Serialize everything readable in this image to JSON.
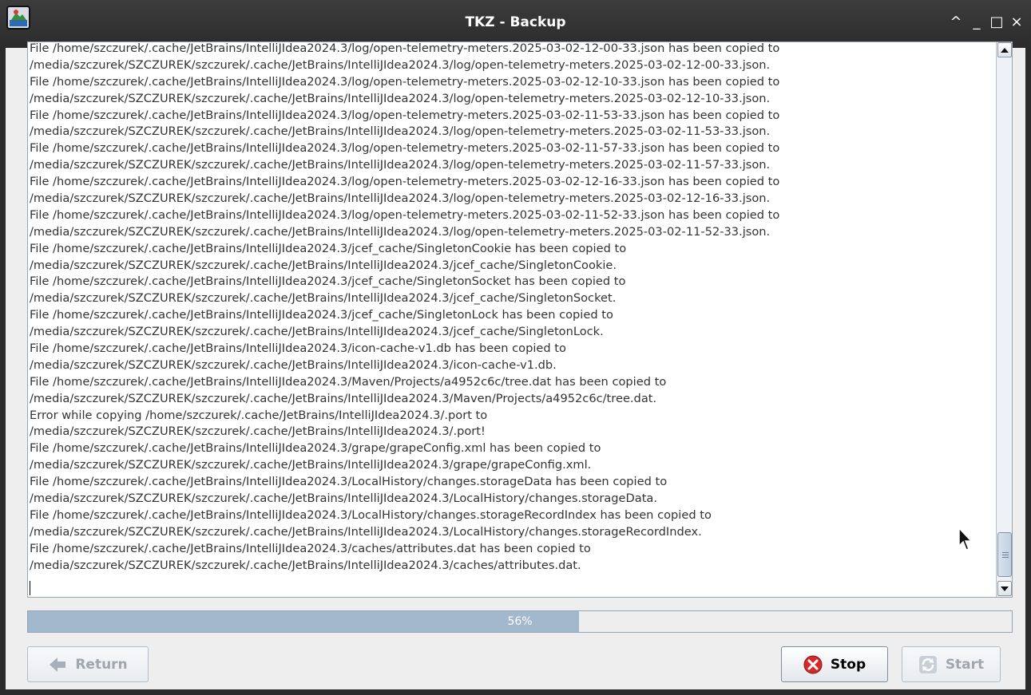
{
  "window": {
    "title": "TKZ - Backup",
    "controls": [
      "^",
      "_",
      "□",
      "×"
    ]
  },
  "log": {
    "lines": [
      "File /home/szczurek/.cache/JetBrains/IntelliJIdea2024.3/log/open-telemetry-meters.2025-03-02-12-00-33.json has been copied to",
      "/media/szczurek/SZCZUREK/szczurek/.cache/JetBrains/IntelliJIdea2024.3/log/open-telemetry-meters.2025-03-02-12-00-33.json.",
      "File /home/szczurek/.cache/JetBrains/IntelliJIdea2024.3/log/open-telemetry-meters.2025-03-02-12-10-33.json has been copied to",
      "/media/szczurek/SZCZUREK/szczurek/.cache/JetBrains/IntelliJIdea2024.3/log/open-telemetry-meters.2025-03-02-12-10-33.json.",
      "File /home/szczurek/.cache/JetBrains/IntelliJIdea2024.3/log/open-telemetry-meters.2025-03-02-11-53-33.json has been copied to",
      "/media/szczurek/SZCZUREK/szczurek/.cache/JetBrains/IntelliJIdea2024.3/log/open-telemetry-meters.2025-03-02-11-53-33.json.",
      "File /home/szczurek/.cache/JetBrains/IntelliJIdea2024.3/log/open-telemetry-meters.2025-03-02-11-57-33.json has been copied to",
      "/media/szczurek/SZCZUREK/szczurek/.cache/JetBrains/IntelliJIdea2024.3/log/open-telemetry-meters.2025-03-02-11-57-33.json.",
      "File /home/szczurek/.cache/JetBrains/IntelliJIdea2024.3/log/open-telemetry-meters.2025-03-02-12-16-33.json has been copied to",
      "/media/szczurek/SZCZUREK/szczurek/.cache/JetBrains/IntelliJIdea2024.3/log/open-telemetry-meters.2025-03-02-12-16-33.json.",
      "File /home/szczurek/.cache/JetBrains/IntelliJIdea2024.3/log/open-telemetry-meters.2025-03-02-11-52-33.json has been copied to",
      "/media/szczurek/SZCZUREK/szczurek/.cache/JetBrains/IntelliJIdea2024.3/log/open-telemetry-meters.2025-03-02-11-52-33.json.",
      "File /home/szczurek/.cache/JetBrains/IntelliJIdea2024.3/jcef_cache/SingletonCookie has been copied to",
      "/media/szczurek/SZCZUREK/szczurek/.cache/JetBrains/IntelliJIdea2024.3/jcef_cache/SingletonCookie.",
      "File /home/szczurek/.cache/JetBrains/IntelliJIdea2024.3/jcef_cache/SingletonSocket has been copied to",
      "/media/szczurek/SZCZUREK/szczurek/.cache/JetBrains/IntelliJIdea2024.3/jcef_cache/SingletonSocket.",
      "File /home/szczurek/.cache/JetBrains/IntelliJIdea2024.3/jcef_cache/SingletonLock has been copied to",
      "/media/szczurek/SZCZUREK/szczurek/.cache/JetBrains/IntelliJIdea2024.3/jcef_cache/SingletonLock.",
      "File /home/szczurek/.cache/JetBrains/IntelliJIdea2024.3/icon-cache-v1.db has been copied to",
      "/media/szczurek/SZCZUREK/szczurek/.cache/JetBrains/IntelliJIdea2024.3/icon-cache-v1.db.",
      "File /home/szczurek/.cache/JetBrains/IntelliJIdea2024.3/Maven/Projects/a4952c6c/tree.dat has been copied to",
      "/media/szczurek/SZCZUREK/szczurek/.cache/JetBrains/IntelliJIdea2024.3/Maven/Projects/a4952c6c/tree.dat.",
      "Error while copying /home/szczurek/.cache/JetBrains/IntelliJIdea2024.3/.port to",
      "/media/szczurek/SZCZUREK/szczurek/.cache/JetBrains/IntelliJIdea2024.3/.port!",
      "File /home/szczurek/.cache/JetBrains/IntelliJIdea2024.3/grape/grapeConfig.xml has been copied to",
      "/media/szczurek/SZCZUREK/szczurek/.cache/JetBrains/IntelliJIdea2024.3/grape/grapeConfig.xml.",
      "File /home/szczurek/.cache/JetBrains/IntelliJIdea2024.3/LocalHistory/changes.storageData has been copied to",
      "/media/szczurek/SZCZUREK/szczurek/.cache/JetBrains/IntelliJIdea2024.3/LocalHistory/changes.storageData.",
      "File /home/szczurek/.cache/JetBrains/IntelliJIdea2024.3/LocalHistory/changes.storageRecordIndex has been copied to",
      "/media/szczurek/SZCZUREK/szczurek/.cache/JetBrains/IntelliJIdea2024.3/LocalHistory/changes.storageRecordIndex.",
      "File /home/szczurek/.cache/JetBrains/IntelliJIdea2024.3/caches/attributes.dat has been copied to",
      "/media/szczurek/SZCZUREK/szczurek/.cache/JetBrains/IntelliJIdea2024.3/caches/attributes.dat."
    ]
  },
  "progress": {
    "value": 56,
    "label": "56%"
  },
  "buttons": {
    "return_label": "Return",
    "stop_label": "Stop",
    "start_label": "Start"
  },
  "colors": {
    "titlebar": "#2b2b2b",
    "progress_fill": "#a2b8cd",
    "stop_icon": "#d42a2a"
  },
  "icons": {
    "return": "arrow-left-icon",
    "stop": "stop-icon",
    "start": "refresh-icon"
  }
}
